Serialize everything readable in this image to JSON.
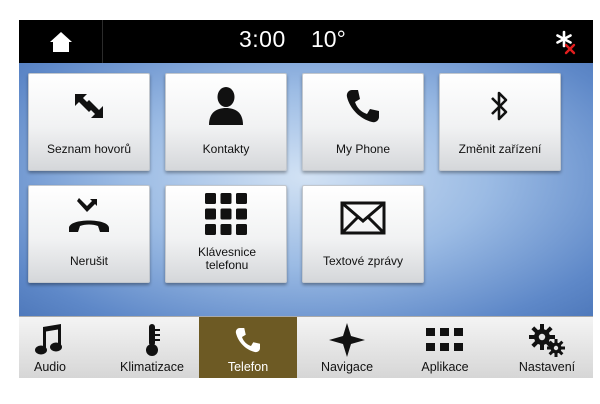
{
  "status_bar": {
    "time": "3:00",
    "temperature": "10°",
    "home_icon": "home-icon",
    "bluetooth_status_icon": "bluetooth-disconnected-icon"
  },
  "tiles": [
    {
      "label": "Seznam hovorů",
      "icon": "call-history-icon"
    },
    {
      "label": "Kontakty",
      "icon": "contact-icon"
    },
    {
      "label": "My Phone",
      "icon": "phone-icon"
    },
    {
      "label": "Změnit zařízení",
      "icon": "bluetooth-icon"
    },
    {
      "label": "Nerušit",
      "icon": "do-not-disturb-icon"
    },
    {
      "label": "Klávesnice telefonu",
      "icon": "keypad-icon"
    },
    {
      "label": "Textové zprávy",
      "icon": "envelope-icon"
    }
  ],
  "bottom_nav": [
    {
      "label": "Audio",
      "icon": "music-note-icon"
    },
    {
      "label": "Klimatizace",
      "icon": "thermometer-icon"
    },
    {
      "label": "Telefon",
      "icon": "phone-icon",
      "active": true
    },
    {
      "label": "Navigace",
      "icon": "compass-star-icon"
    },
    {
      "label": "Aplikace",
      "icon": "apps-grid-icon"
    },
    {
      "label": "Nastavení",
      "icon": "gears-icon"
    }
  ],
  "colors": {
    "active_nav": "#6d5a24",
    "background_blue": "#6b93cf",
    "status_bar": "#000000"
  }
}
